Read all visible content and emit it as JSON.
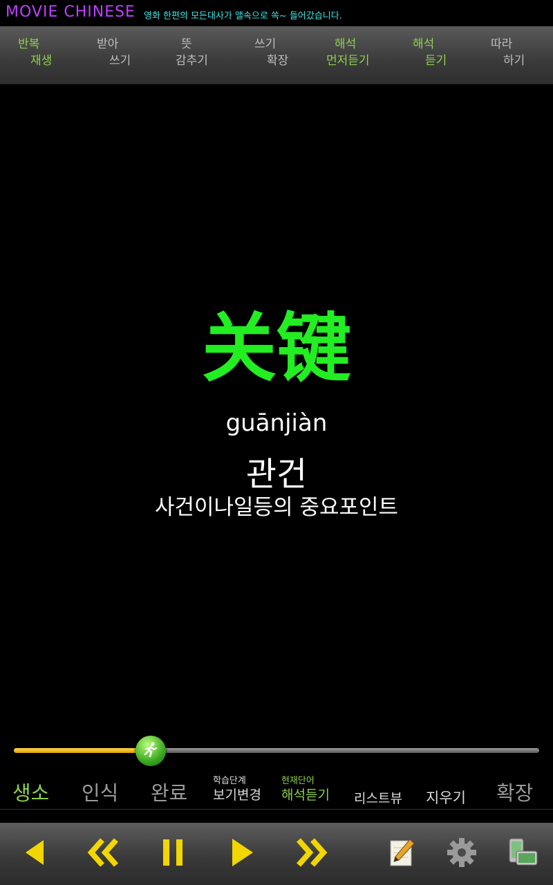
{
  "header": {
    "brand": "MOVIE CHINESE",
    "tagline": "영화 한편의 모든대사가 앨속으로 쏙~ 들어갔습니다."
  },
  "modes": [
    {
      "line1": "반복",
      "line2": "재생",
      "color": "#8fd14a"
    },
    {
      "line1": "받아",
      "line2": "쓰기",
      "color": "#bdbdbd"
    },
    {
      "line1": "뜻",
      "line2": "감추기",
      "color": "#bdbdbd"
    },
    {
      "line1": "쓰기",
      "line2": "확장",
      "color": "#bdbdbd"
    },
    {
      "line1": "해석",
      "line2": "먼저듣기",
      "color": "#8fd14a"
    },
    {
      "line1": "해석",
      "line2": "듣기",
      "color": "#8fd14a"
    },
    {
      "line1": "따라",
      "line2": "하기",
      "color": "#bdbdbd"
    }
  ],
  "card": {
    "word": "关键",
    "pinyin": "guānjiàn",
    "korean": "관건",
    "meaning": "사건이나일등의 중요포인트"
  },
  "progress": {
    "fraction": 0.26
  },
  "status": {
    "new": "생소",
    "recognized": "인식",
    "done": "완료",
    "view_change_top": "학습단계",
    "view_change_bottom": "보기변경",
    "listen_top": "현재단어",
    "listen_bottom": "해석듣기",
    "listview": "리스트뷰",
    "erase": "지우기",
    "expand": "확장"
  },
  "icons": {
    "prev": "triangle-left-icon",
    "rewind": "double-chevron-left-icon",
    "pause": "pause-icon",
    "play": "play-icon",
    "forward": "double-chevron-right-icon",
    "edit": "pencil-notepad-icon",
    "settings": "gear-icon",
    "apps": "phone-apps-icon"
  },
  "colors": {
    "accent_yellow": "#f2d600",
    "word_green": "#22ee22",
    "active_green": "#8fd14a",
    "brand_purple": "#c040ff",
    "tagline_cyan": "#3ee6e6"
  }
}
